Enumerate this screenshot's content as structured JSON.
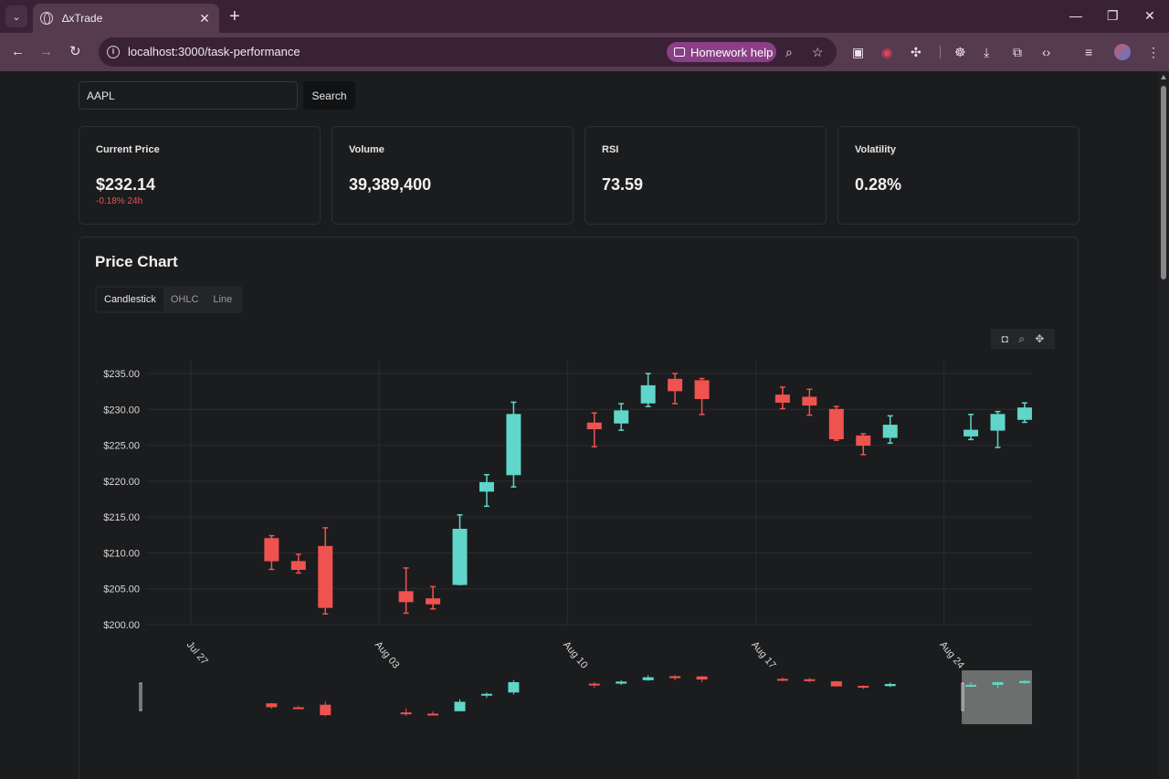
{
  "browser": {
    "tab_title": "∆xTrade",
    "url": "localhost:3000/task-performance",
    "homework_help": "Homework help",
    "controls": {
      "minimize": "—",
      "restore": "❐",
      "close": "✕",
      "new_tab": "+",
      "tab_close": "✕",
      "tab_menu": "⌄"
    },
    "nav": {
      "back": "←",
      "forward": "→",
      "reload": "↻"
    },
    "omnibox_icons": [
      "zoom-icon",
      "star-icon"
    ],
    "extensions": [
      "cast-icon",
      "record-icon",
      "puzzle-icon",
      "bug-icon",
      "download-icon",
      "screenshot-icon",
      "code-icon",
      "media-icon",
      "profile-avatar",
      "kebab-menu-icon"
    ]
  },
  "search": {
    "value": "AAPL",
    "button_label": "Search"
  },
  "cards": [
    {
      "label": "Current Price",
      "value": "$232.14",
      "change": "-0.18% 24h"
    },
    {
      "label": "Volume",
      "value": "39,389,400"
    },
    {
      "label": "RSI",
      "value": "73.59"
    },
    {
      "label": "Volatility",
      "value": "0.28%"
    }
  ],
  "chart": {
    "title": "Price Chart",
    "types": [
      "Candlestick",
      "OHLC",
      "Line"
    ],
    "active_type": "Candlestick",
    "modebar": [
      "camera-icon",
      "zoom-icon",
      "pan-icon"
    ]
  },
  "colors": {
    "up": "#5fd6c9",
    "down": "#ef5350",
    "grid": "#2a2c30",
    "text": "#d8d8d8"
  },
  "chart_data": {
    "type": "candlestick",
    "title": "",
    "xlabel": "",
    "ylabel": "",
    "ylim": [
      200,
      235
    ],
    "yticks": [
      200,
      205,
      210,
      215,
      220,
      225,
      230,
      235
    ],
    "ytick_labels": [
      "$200.00",
      "$205.00",
      "$210.00",
      "$215.00",
      "$220.00",
      "$225.00",
      "$230.00",
      "$235.00"
    ],
    "xticks": [
      "2024-07-27",
      "2024-08-03",
      "2024-08-10",
      "2024-08-17",
      "2024-08-24"
    ],
    "xtick_labels": [
      "Jul 27",
      "Aug 03",
      "Aug 10",
      "Aug 17",
      "Aug 24"
    ],
    "candles": [
      {
        "date": "2024-07-30",
        "open": 212.0,
        "high": 212.4,
        "low": 207.7,
        "close": 208.9
      },
      {
        "date": "2024-07-31",
        "open": 208.8,
        "high": 209.8,
        "low": 207.2,
        "close": 207.7
      },
      {
        "date": "2024-08-01",
        "open": 210.9,
        "high": 213.5,
        "low": 201.5,
        "close": 202.4
      },
      {
        "date": "2024-08-04",
        "open": 204.6,
        "high": 207.9,
        "low": 201.6,
        "close": 203.2
      },
      {
        "date": "2024-08-05",
        "open": 203.6,
        "high": 205.3,
        "low": 202.2,
        "close": 202.9
      },
      {
        "date": "2024-08-06",
        "open": 205.6,
        "high": 215.3,
        "low": 205.6,
        "close": 213.3
      },
      {
        "date": "2024-08-07",
        "open": 218.6,
        "high": 220.9,
        "low": 216.5,
        "close": 219.8
      },
      {
        "date": "2024-08-08",
        "open": 220.9,
        "high": 231.0,
        "low": 219.2,
        "close": 229.3
      },
      {
        "date": "2024-08-11",
        "open": 228.1,
        "high": 229.5,
        "low": 224.8,
        "close": 227.3
      },
      {
        "date": "2024-08-12",
        "open": 228.1,
        "high": 230.8,
        "low": 227.1,
        "close": 229.8
      },
      {
        "date": "2024-08-13",
        "open": 230.9,
        "high": 235.0,
        "low": 230.4,
        "close": 233.3
      },
      {
        "date": "2024-08-14",
        "open": 234.2,
        "high": 235.0,
        "low": 230.8,
        "close": 232.6
      },
      {
        "date": "2024-08-15",
        "open": 234.0,
        "high": 234.3,
        "low": 229.3,
        "close": 231.5
      },
      {
        "date": "2024-08-18",
        "open": 232.0,
        "high": 233.1,
        "low": 230.1,
        "close": 231.0
      },
      {
        "date": "2024-08-19",
        "open": 231.7,
        "high": 232.8,
        "low": 229.2,
        "close": 230.6
      },
      {
        "date": "2024-08-20",
        "open": 230.0,
        "high": 230.4,
        "low": 225.7,
        "close": 225.9
      },
      {
        "date": "2024-08-21",
        "open": 226.3,
        "high": 226.6,
        "low": 223.7,
        "close": 225.0
      },
      {
        "date": "2024-08-22",
        "open": 226.1,
        "high": 229.1,
        "low": 225.3,
        "close": 227.8
      },
      {
        "date": "2024-08-25",
        "open": 226.3,
        "high": 229.3,
        "low": 225.8,
        "close": 227.1
      },
      {
        "date": "2024-08-26",
        "open": 227.1,
        "high": 229.7,
        "low": 224.7,
        "close": 229.3
      },
      {
        "date": "2024-08-27",
        "open": 228.6,
        "high": 230.9,
        "low": 228.2,
        "close": 230.2
      }
    ],
    "range_slider": {
      "selected_from": "2024-08-25",
      "selected_to": "2024-08-27"
    }
  }
}
